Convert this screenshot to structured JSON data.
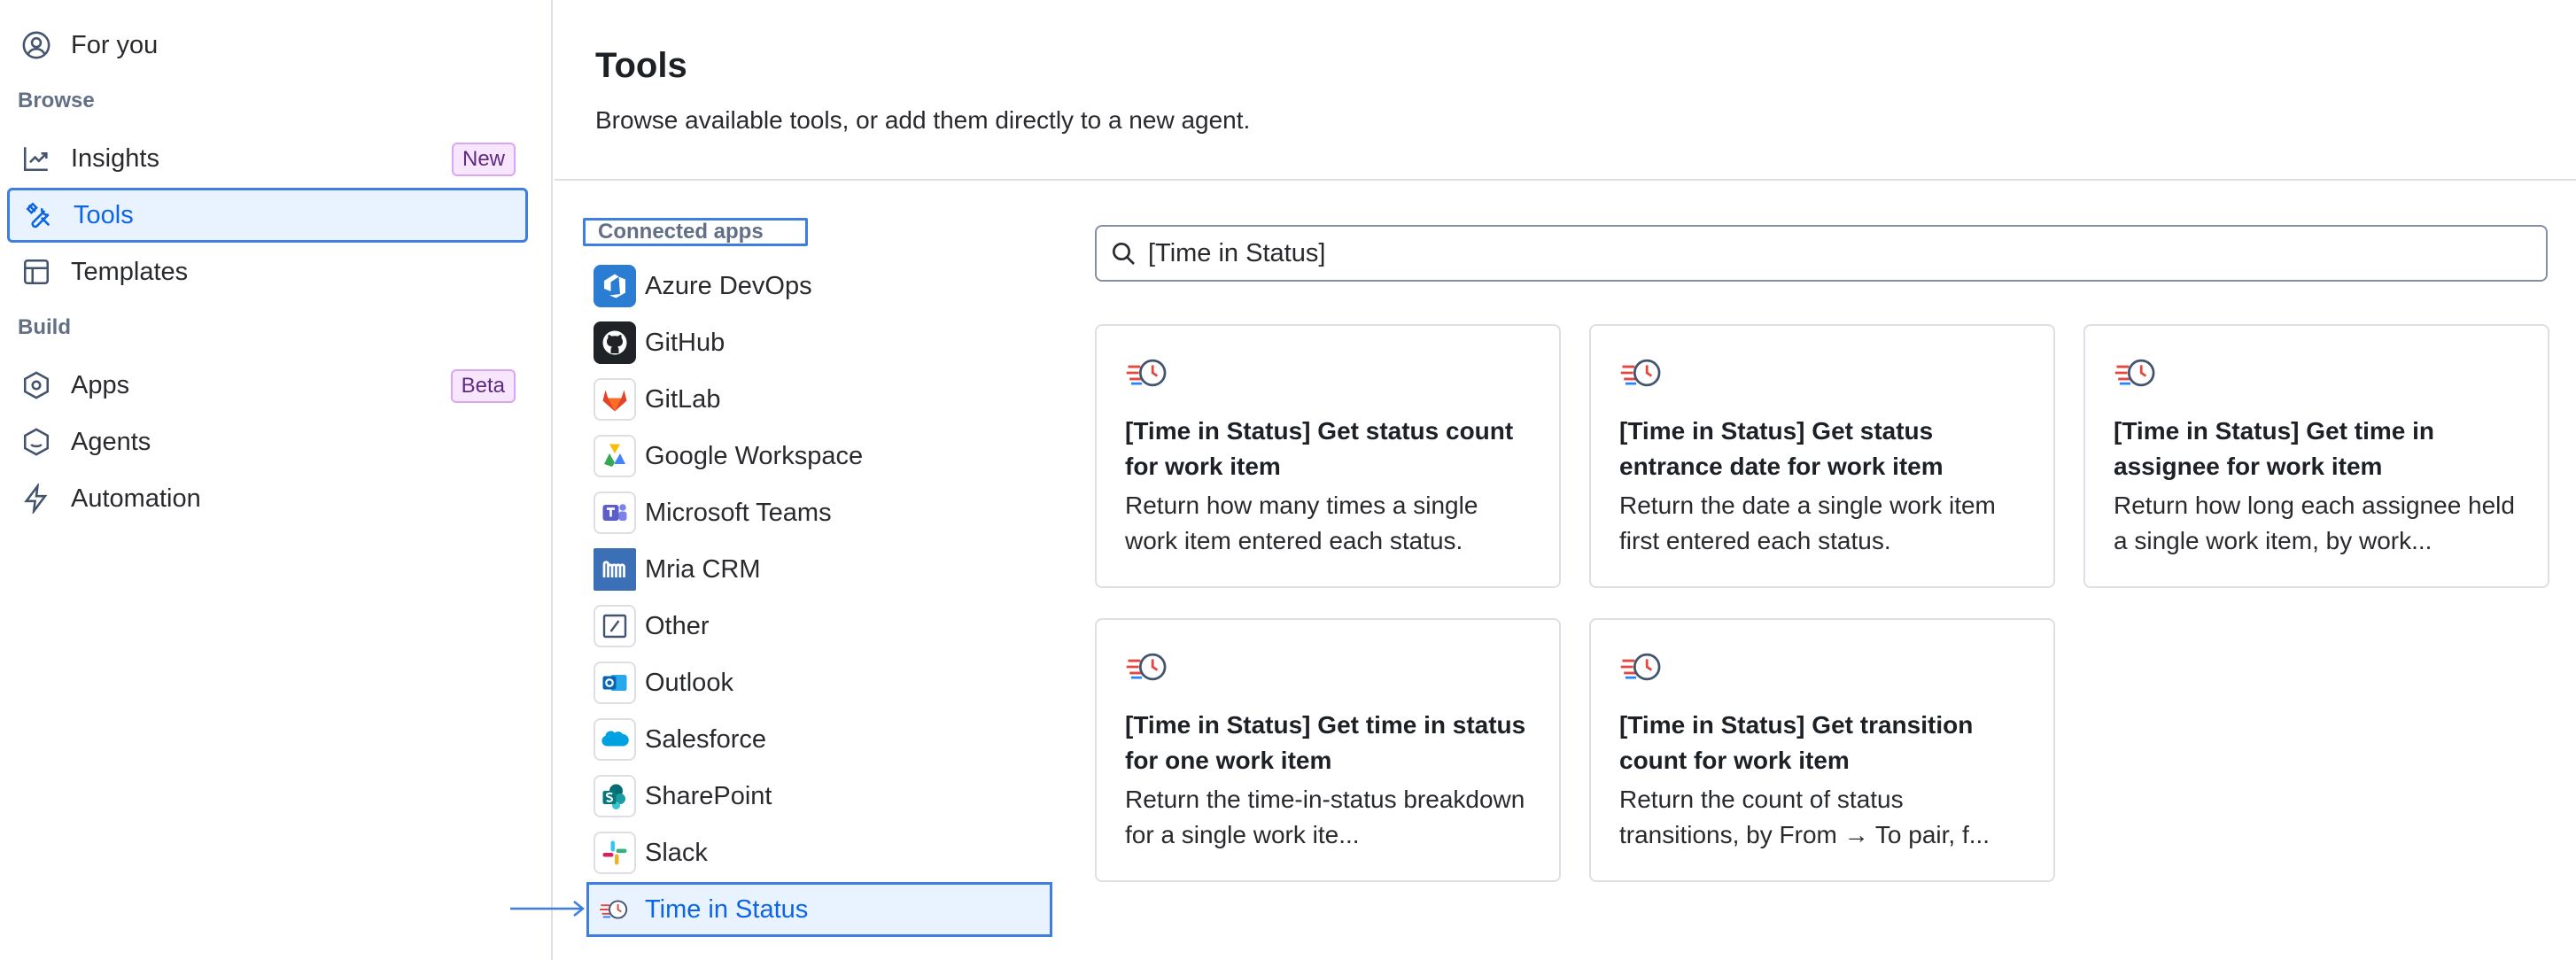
{
  "sidebar": {
    "for_you": "For you",
    "browse_label": "Browse",
    "insights": "Insights",
    "insights_badge": "New",
    "tools": "Tools",
    "templates": "Templates",
    "build_label": "Build",
    "apps": "Apps",
    "apps_badge": "Beta",
    "agents": "Agents",
    "automation": "Automation"
  },
  "header": {
    "title": "Tools",
    "subtitle": "Browse available tools, or add them directly to a new agent."
  },
  "apps": {
    "heading": "Connected apps",
    "items": [
      {
        "label": "Azure DevOps",
        "icon": "azure-devops-icon"
      },
      {
        "label": "GitHub",
        "icon": "github-icon"
      },
      {
        "label": "GitLab",
        "icon": "gitlab-icon"
      },
      {
        "label": "Google Workspace",
        "icon": "google-workspace-icon"
      },
      {
        "label": "Microsoft Teams",
        "icon": "microsoft-teams-icon"
      },
      {
        "label": "Mria CRM",
        "icon": "mria-crm-icon"
      },
      {
        "label": "Other",
        "icon": "other-icon"
      },
      {
        "label": "Outlook",
        "icon": "outlook-icon"
      },
      {
        "label": "Salesforce",
        "icon": "salesforce-icon"
      },
      {
        "label": "SharePoint",
        "icon": "sharepoint-icon"
      },
      {
        "label": "Slack",
        "icon": "slack-icon"
      },
      {
        "label": "Time in Status",
        "icon": "time-in-status-icon"
      }
    ],
    "selected": "Time in Status"
  },
  "search": {
    "value": "[Time in Status]"
  },
  "cards": [
    {
      "title": "[Time in Status] Get status count for work item",
      "desc": "Return how many times a single work item entered each status."
    },
    {
      "title": "[Time in Status] Get status entrance date for work item",
      "desc": "Return the date a single work item first entered each status."
    },
    {
      "title": "[Time in Status] Get time in assignee for work item",
      "desc": "Return how long each assignee held a single work item, by work..."
    },
    {
      "title": "[Time in Status] Get time in status for one work item",
      "desc": "Return the time-in-status breakdown for a single work ite..."
    },
    {
      "title": "[Time in Status] Get transition count for work item",
      "desc": "Return the count of status transitions, by From → To pair, f..."
    }
  ],
  "colors": {
    "accent": "#0c66e4",
    "selected_bg": "#e9f2ff",
    "border": "#dcdfe4"
  }
}
